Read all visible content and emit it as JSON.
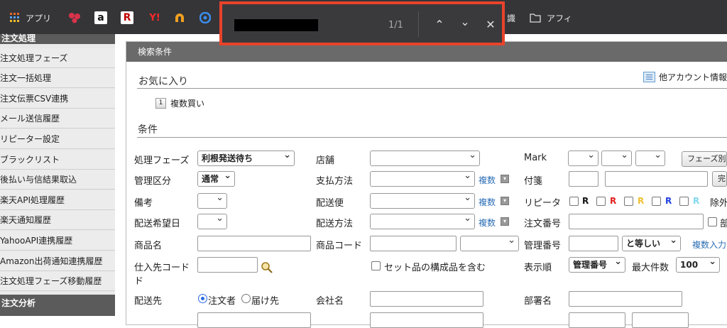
{
  "bookmarks": {
    "apps": "アプリ",
    "partial_label": "識",
    "folder": "アフィ"
  },
  "find": {
    "count": "1/1"
  },
  "sidebar": {
    "header1": "注文処理",
    "items": [
      "注文処理フェーズ",
      "注文一括処理",
      "注文伝票CSV連携",
      "メール送信履歴",
      "リピーター設定",
      "ブラックリスト",
      "後払い与信結果取込",
      "楽天API処理履歴",
      "楽天通知履歴",
      "YahooAPI連携履歴",
      "Amazon出荷通知連携履歴",
      "注文処理フェーズ移動履歴"
    ],
    "header2": "注文分析"
  },
  "panel": {
    "title": "検索条件",
    "favorites": "お気に入り",
    "other_account": "他アカウント情報",
    "fav_item": "複数買い",
    "fav_icon_char": "1",
    "conditions": "条件"
  },
  "form": {
    "phase_label": "処理フェーズ",
    "phase_value": "利根発送待ち",
    "store_label": "店舗",
    "mark_label": "Mark",
    "phase_other_btn": "フェーズ別",
    "mgmt_label": "管理区分",
    "mgmt_value": "通常",
    "pay_label": "支払方法",
    "multi": "複数",
    "tag_label": "付箋",
    "complete_btn": "完",
    "note_label": "備考",
    "ship_label": "配送便",
    "repeater_label": "リピータ",
    "repeater_marks": [
      "R",
      "R",
      "R",
      "R",
      "R"
    ],
    "repeater_colors": [
      "#111111",
      "#e02020",
      "#f0c030",
      "#2040e0",
      "#80d8f0"
    ],
    "exclude_label": "除外",
    "ship_date_label": "配送希望日",
    "ship_method_label": "配送方法",
    "order_no_label": "注文番号",
    "order_no_cb": "部",
    "product_name_label": "商品名",
    "product_code_label": "商品コード",
    "control_no_label": "管理番号",
    "control_match_value": "と等しい",
    "multi_input": "複数入力",
    "supplier_code_label": "仕入先コード",
    "set_item_label": "セット品の構成品を含む",
    "order_label": "表示順",
    "order_value": "管理番号",
    "max_label": "最大件数",
    "max_value": "100",
    "dest_label": "配送先",
    "dest_opt1": "注文者",
    "dest_opt2": "届け先",
    "company_label": "会社名",
    "dept_label": "部署名"
  }
}
